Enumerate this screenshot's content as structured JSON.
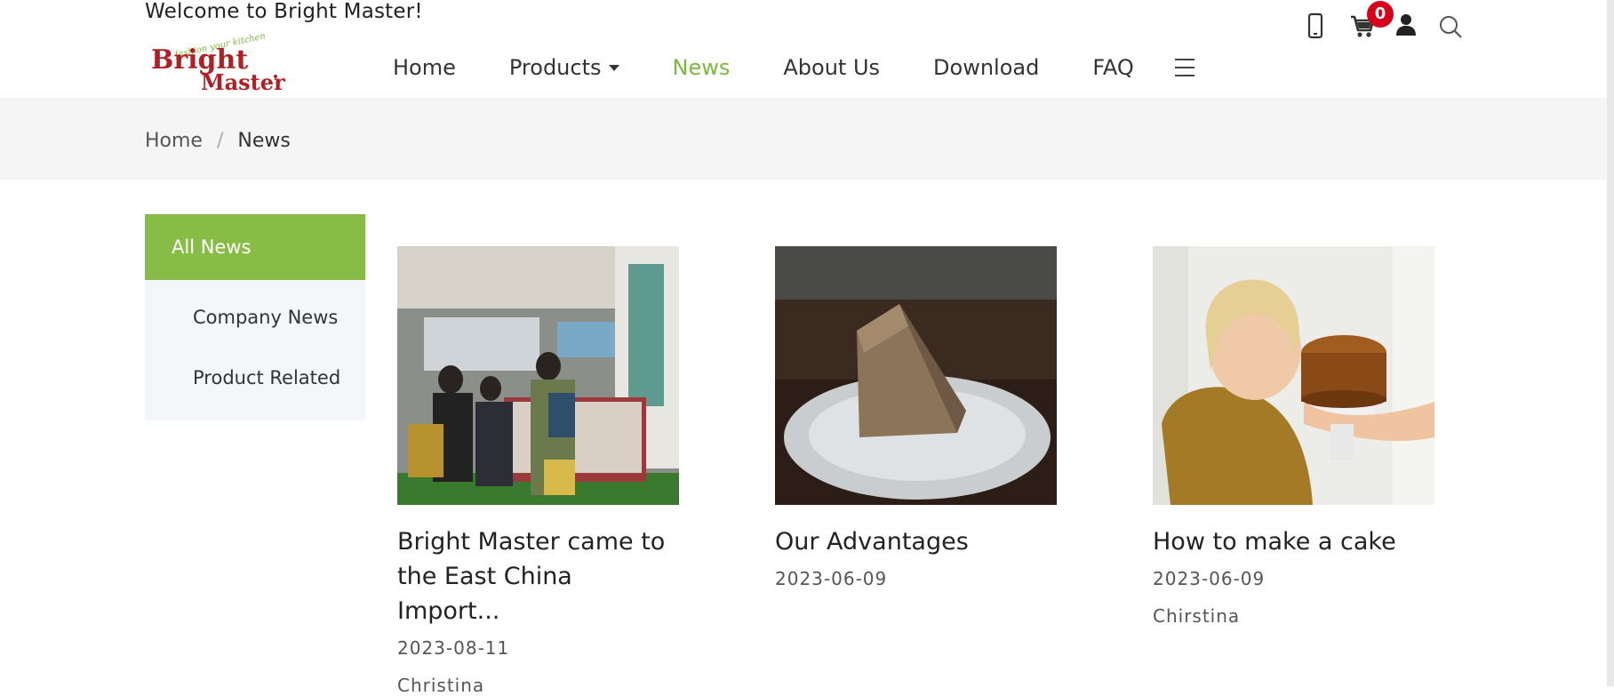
{
  "header": {
    "welcome": "Welcome to Bright Master!",
    "logo": {
      "tagline": "fashion your kitchen",
      "line1": "Bright",
      "line2": "Master"
    },
    "cart_count": "0",
    "icons": [
      "phone-icon",
      "cart-icon",
      "user-icon",
      "search-icon"
    ]
  },
  "nav": {
    "home": "Home",
    "products": "Products",
    "news": "News",
    "about": "About Us",
    "download": "Download",
    "faq": "FAQ"
  },
  "breadcrumb": {
    "home": "Home",
    "separator": "/",
    "current": "News"
  },
  "sidebar": {
    "all": "All News",
    "items": [
      {
        "label": "Company News"
      },
      {
        "label": "Product Related"
      }
    ]
  },
  "articles": [
    {
      "title": "Bright Master came to the East China Import...",
      "date": "2023-08-11",
      "author": "Christina"
    },
    {
      "title": "Our Advantages",
      "date": "2023-06-09",
      "author": ""
    },
    {
      "title": "How to make a cake",
      "date": "2023-06-09",
      "author": "Chirstina"
    }
  ],
  "colors": {
    "accent": "#87bd46",
    "brand": "#b11e24",
    "badge": "#d6001c"
  }
}
